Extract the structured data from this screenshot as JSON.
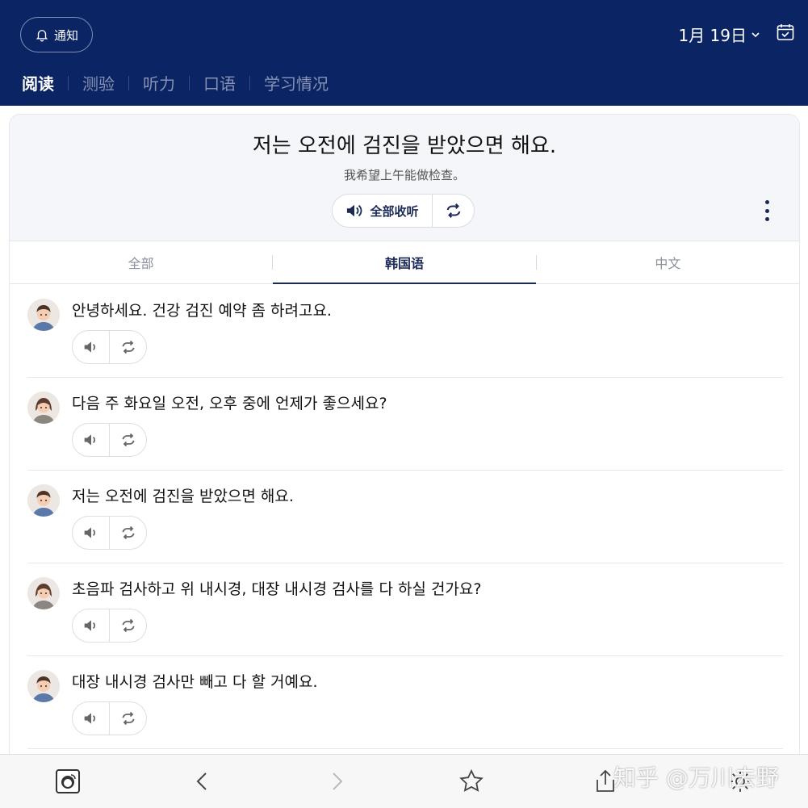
{
  "header": {
    "notify_label": "通知",
    "date_label": "1月 19日",
    "tabs": [
      {
        "label": "阅读",
        "active": true
      },
      {
        "label": "测验",
        "active": false
      },
      {
        "label": "听力",
        "active": false
      },
      {
        "label": "口语",
        "active": false
      },
      {
        "label": "学习情况",
        "active": false
      }
    ]
  },
  "sentence": {
    "korean": "저는 오전에 검진을 받았으면 해요.",
    "chinese": "我希望上午能做检查。",
    "listen_all_label": "全部收听"
  },
  "language_tabs": [
    {
      "label": "全部",
      "active": false
    },
    {
      "label": "韩国语",
      "active": true
    },
    {
      "label": "中文",
      "active": false
    }
  ],
  "dialogue": [
    {
      "speaker": "male",
      "text": "안녕하세요. 건강 검진 예약 좀 하려고요."
    },
    {
      "speaker": "female",
      "text": "다음 주 화요일 오전, 오후 중에 언제가 좋으세요?"
    },
    {
      "speaker": "male",
      "text": "저는 오전에 검진을 받았으면 해요."
    },
    {
      "speaker": "female",
      "text": "초음파 검사하고 위 내시경, 대장 내시경 검사를 다 하실 건가요?"
    },
    {
      "speaker": "male",
      "text": "대장 내시경 검사만 빼고 다 할 거예요."
    }
  ],
  "bottom_bar": {
    "icons": [
      "avatar-icon",
      "back-arrow-icon",
      "forward-arrow-icon",
      "star-icon",
      "share-icon",
      "settings-icon"
    ]
  },
  "watermark": "知乎 @万川去野",
  "colors": {
    "header_bg": "#0b2464",
    "accent": "#1b2a55"
  }
}
